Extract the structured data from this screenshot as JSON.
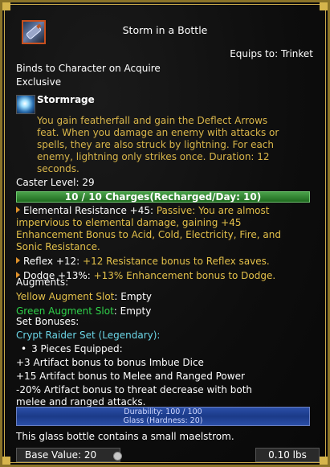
{
  "item": {
    "name": "Storm in a Bottle",
    "icon": "bottle-icon",
    "equips_to": "Equips to: Trinket",
    "binding": "Binds to Character on Acquire",
    "exclusive": "Exclusive"
  },
  "effect": {
    "icon": "lightning-orb-icon",
    "name": "Stormrage",
    "description_lines": [
      "You gain featherfall and gain the Deflect Arrows",
      "feat. When you damage an enemy with attacks or",
      "spells, they are also struck by lightning. For each",
      "enemy, lightning only strikes once. Duration: 12",
      "seconds."
    ]
  },
  "caster_level": "Caster Level: 29",
  "charges": "10 / 10 Charges(Recharged/Day: 10)",
  "bonuses": [
    {
      "label": "Elemental Resistance +45:",
      "text_lines": [
        " Passive: You are almost",
        "impervious to elemental damage, gaining +45",
        "Enhancement Bonus to Acid, Cold, Electricity, Fire, and",
        "Sonic Resistance."
      ]
    },
    {
      "label": "Reflex +12:",
      "text_lines": [
        " +12 Resistance bonus to Reflex saves."
      ]
    },
    {
      "label": "Dodge +13%:",
      "text_lines": [
        " +13% Enhancement bonus to Dodge."
      ]
    }
  ],
  "augments": {
    "header": "Augments:",
    "yellow_label": "Yellow Augment Slot",
    "yellow_value": ": Empty",
    "green_label": "Green Augment Slot",
    "green_value": ": Empty"
  },
  "set_bonuses": {
    "header": "Set Bonuses:",
    "set_name": "Crypt Raider Set (Legendary):",
    "pieces": "3 Pieces Equipped:",
    "lines": [
      "+3 Artifact bonus to bonus Imbue Dice",
      "+15 Artifact bonus to Melee and Ranged Power",
      "-20% Artifact bonus to threat decrease with both",
      "melee and ranged attacks."
    ]
  },
  "durability": {
    "line1": "Durability: 100 / 100",
    "line2": "Glass (Hardness: 20)"
  },
  "flavor": "This glass bottle contains a small maelstrom.",
  "base_value": "Base Value: 20",
  "weight": "0.10 lbs",
  "colors": {
    "gold_text": "#e3c04a",
    "green_text": "#2fd14a",
    "cyan_text": "#6cd7e8",
    "charges_bar": "#3a8f3a",
    "durability_bar": "#2648a0",
    "frame": "#c9a94a"
  }
}
